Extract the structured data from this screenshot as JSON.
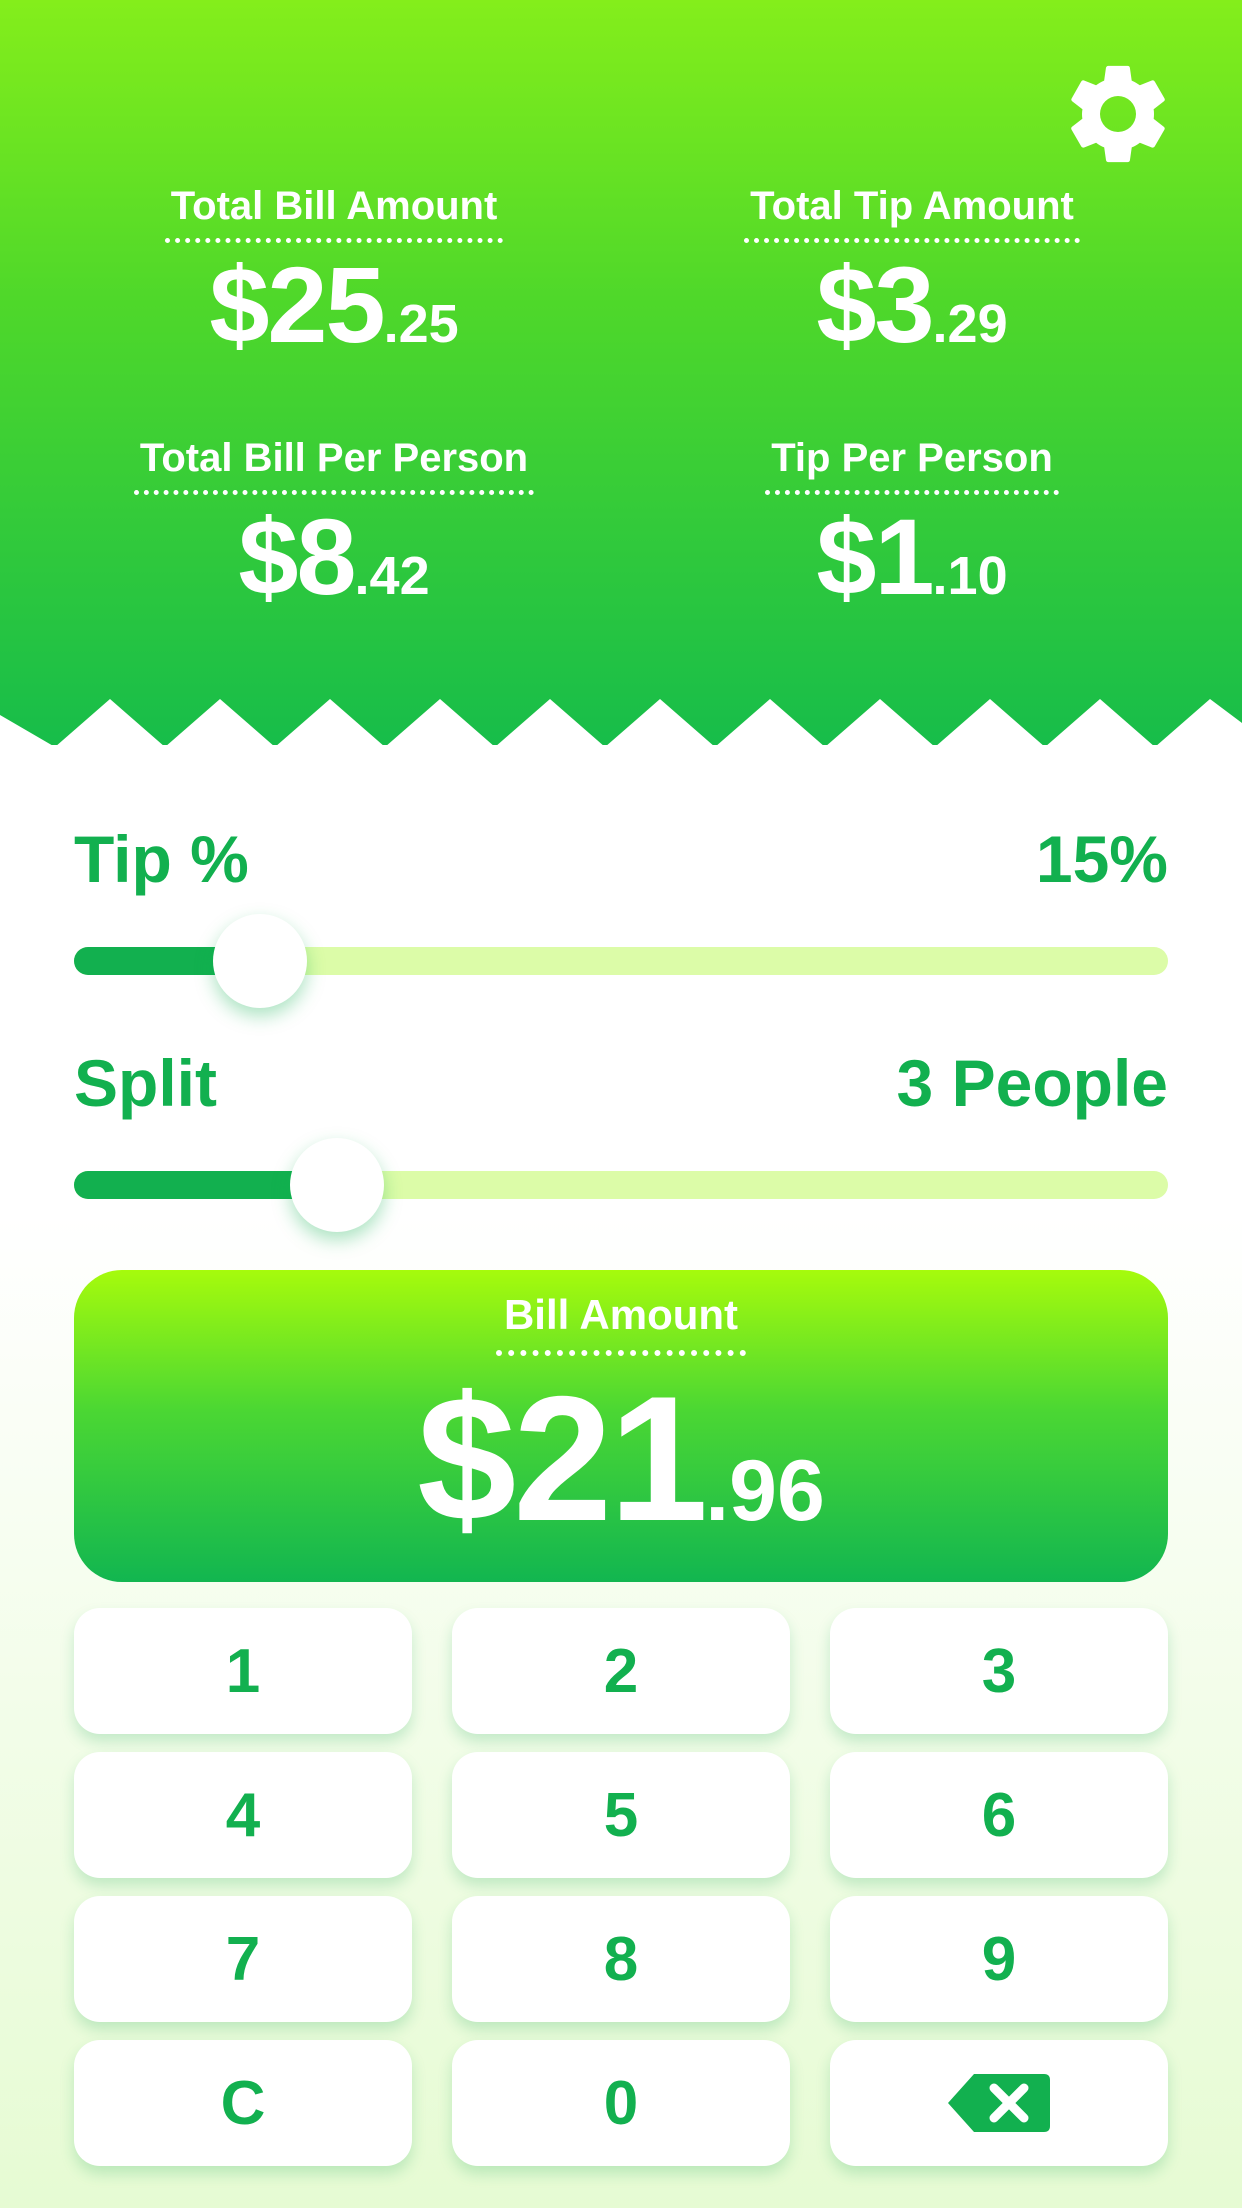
{
  "summary": {
    "total_bill": {
      "label": "Total Bill Amount",
      "dollars": "$25",
      "cents": ".25"
    },
    "total_tip": {
      "label": "Total Tip Amount",
      "dollars": "$3",
      "cents": ".29"
    },
    "bill_per_person": {
      "label": "Total Bill Per Person",
      "dollars": "$8",
      "cents": ".42"
    },
    "tip_per_person": {
      "label": "Tip Per Person",
      "dollars": "$1",
      "cents": ".10"
    }
  },
  "tip": {
    "label": "Tip %",
    "value": "15%",
    "slider_level_percent": 17
  },
  "split": {
    "label": "Split",
    "value": "3 People",
    "slider_level_percent": 24
  },
  "bill": {
    "label": "Bill Amount",
    "dollars": "$21",
    "cents": ".96"
  },
  "keypad": {
    "k1": "1",
    "k2": "2",
    "k3": "3",
    "k4": "4",
    "k5": "5",
    "k6": "6",
    "k7": "7",
    "k8": "8",
    "k9": "9",
    "clear": "C",
    "k0": "0"
  },
  "icons": {
    "settings": "gear-icon",
    "backspace": "backspace-icon"
  },
  "colors": {
    "accent": "#12b04f",
    "track": "#dcfca8",
    "header_top": "#84ee1b",
    "header_bottom": "#17bd4a"
  }
}
